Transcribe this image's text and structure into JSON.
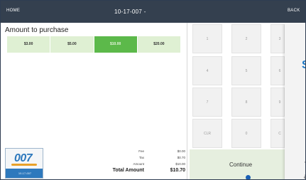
{
  "topbar": {
    "home": "HOME",
    "title": "10-17-007 -",
    "back": "BACK"
  },
  "purchase": {
    "heading": "Amount to purchase",
    "options": [
      {
        "label": "$3.00",
        "selected": false
      },
      {
        "label": "$5.00",
        "selected": false
      },
      {
        "label": "$10.00",
        "selected": true
      },
      {
        "label": "$20.00",
        "selected": false
      }
    ]
  },
  "logo": {
    "text": "007",
    "id": "10-17-007"
  },
  "summary": {
    "rows": [
      {
        "label": "Fee",
        "value": "$0.00"
      },
      {
        "label": "Tax",
        "value": "$0.70"
      },
      {
        "label": "Amount",
        "value": "$10.00"
      }
    ],
    "total_label": "Total Amount",
    "total_value": "$10.70"
  },
  "keypad": {
    "keys": [
      "1",
      "2",
      "4",
      "5",
      "7",
      "8",
      "CLR",
      "0"
    ],
    "partial": [
      "3",
      "6",
      "9",
      "C"
    ]
  },
  "continue_label": "Continue",
  "overlay": {
    "big": "S",
    "small_line1": "T",
    "small_line2": "a"
  },
  "colors": {
    "topbar": "#34404f",
    "selected": "#5cb94a",
    "option": "#dff0d3",
    "accent_blue": "#1e79c6"
  }
}
